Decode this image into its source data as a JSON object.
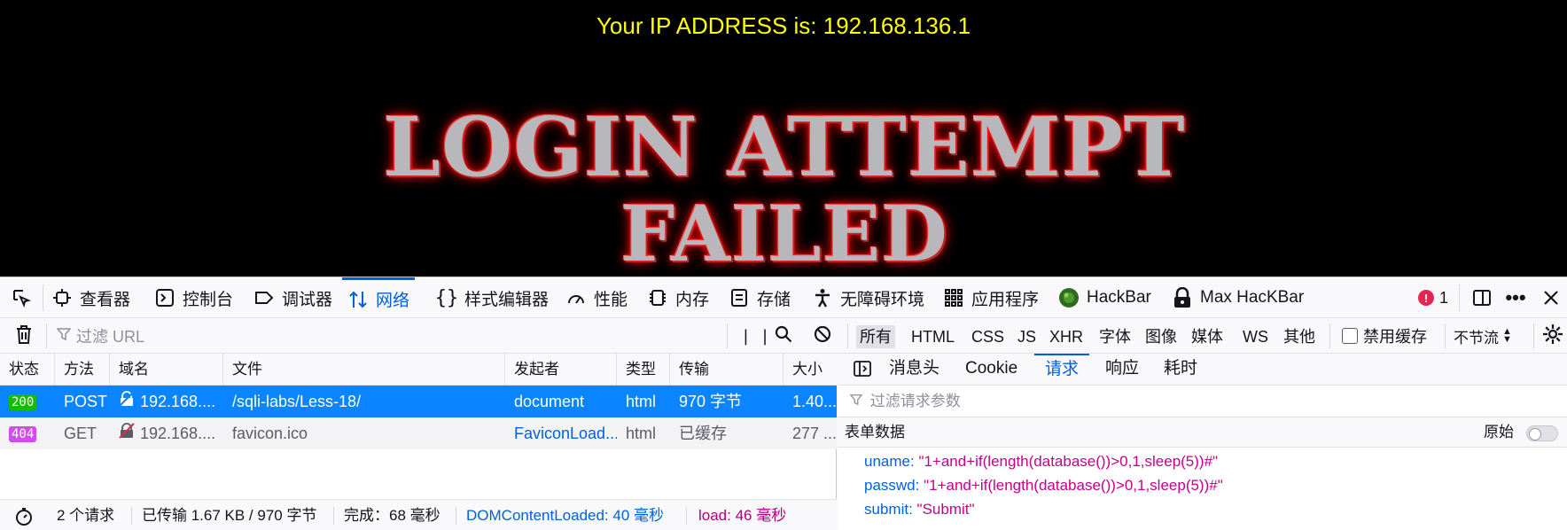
{
  "page": {
    "ip_text": "Your IP ADDRESS is: 192.168.136.1",
    "banner_line1": "LOGIN ATTEMPT",
    "banner_line2": "FAILED",
    "ip_color": "#ffff00",
    "banner_glow_color": "#ff1010"
  },
  "devtools": {
    "tools": [
      {
        "label": "查看器",
        "icon": "inspector-icon"
      },
      {
        "label": "控制台",
        "icon": "console-icon"
      },
      {
        "label": "调试器",
        "icon": "debugger-icon"
      },
      {
        "label": "网络",
        "icon": "network-icon",
        "active": true
      },
      {
        "label": "样式编辑器",
        "icon": "style-editor-icon"
      },
      {
        "label": "性能",
        "icon": "performance-icon"
      },
      {
        "label": "内存",
        "icon": "memory-icon"
      },
      {
        "label": "存储",
        "icon": "storage-icon"
      },
      {
        "label": "无障碍环境",
        "icon": "accessibility-icon"
      },
      {
        "label": "应用程序",
        "icon": "application-icon"
      },
      {
        "label": "HackBar",
        "icon": "hackbar-icon"
      },
      {
        "label": "Max HacKBar",
        "icon": "max-hackbar-icon"
      }
    ],
    "error_count": "1",
    "accent_color": "#0060df"
  },
  "filterbar": {
    "url_placeholder": "过滤 URL",
    "types": [
      "所有",
      "HTML",
      "CSS",
      "JS",
      "XHR",
      "字体",
      "图像",
      "媒体",
      "WS",
      "其他"
    ],
    "selected_type": "所有",
    "disable_cache_label": "禁用缓存",
    "throttle_label": "不节流"
  },
  "table": {
    "columns": [
      "状态",
      "方法",
      "域名",
      "文件",
      "发起者",
      "类型",
      "传输",
      "大小"
    ],
    "rows": [
      {
        "status": "200",
        "method": "POST",
        "domain": "192.168....",
        "file": "/sqli-labs/Less-18/",
        "initiator": "document",
        "type": "html",
        "transferred": "970 字节",
        "size": "1.40..."
      },
      {
        "status": "404",
        "method": "GET",
        "domain": "192.168....",
        "file": "favicon.ico",
        "initiator": "FaviconLoad...",
        "type": "html",
        "transferred": "已缓存",
        "size": "277 ..."
      }
    ],
    "status_colors": {
      "200": "#12bc00",
      "404": "#d04ee8"
    }
  },
  "statusbar": {
    "requests": "2 个请求",
    "transferred": "已传输 1.67 KB / 970 字节",
    "finish": "完成：68 毫秒",
    "dom_content_loaded": "DOMContentLoaded: 40 毫秒",
    "load": "load: 46 毫秒"
  },
  "details": {
    "tabs": [
      "消息头",
      "Cookie",
      "请求",
      "响应",
      "耗时"
    ],
    "active_tab": "请求",
    "param_filter_placeholder": "过滤请求参数",
    "form_heading": "表单数据",
    "raw_label": "原始",
    "params": [
      {
        "key": "uname:",
        "value": "\"1+and+if(length(database())>0,1,sleep(5))#\""
      },
      {
        "key": "passwd:",
        "value": "\"1+and+if(length(database())>0,1,sleep(5))#\""
      },
      {
        "key": "submit:",
        "value": "\"Submit\""
      }
    ]
  }
}
